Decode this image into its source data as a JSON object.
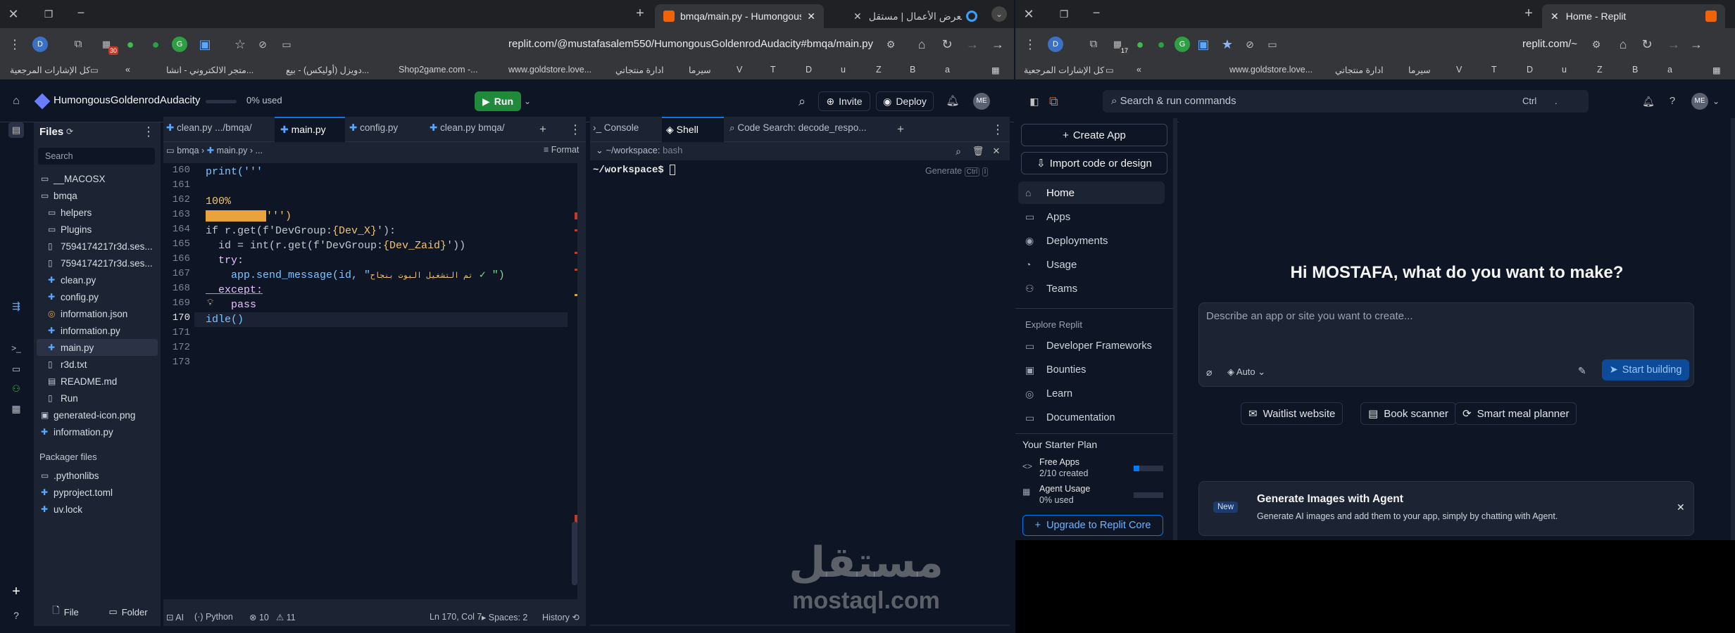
{
  "left_window": {
    "tabs": [
      {
        "title": "bmqa/main.py - HumongousG",
        "active": true
      },
      {
        "title": "إضافة معرض الأعمال | مستقل",
        "active": false
      }
    ],
    "url": "replit.com/@mustafasalem550/HumongousGoldenrodAudacity#bmqa/main.py",
    "ext_badge": "30",
    "bookmarks": [
      "كل الإشارات المرجعية",
      "متجر الالكتروني - انشا...",
      "دويزل (أوليكس) - بيع...",
      "Shop2game.com -...",
      "www.goldstore.love...",
      "ادارة منتجاتي",
      "سيرما",
      "V",
      "T",
      "D",
      "u",
      "Z",
      "B",
      "a"
    ]
  },
  "right_window": {
    "tabs": [
      {
        "title": "Home - Replit",
        "active": true
      }
    ],
    "url": "replit.com/~",
    "ext_badge": "17",
    "bookmarks": [
      "كل الإشارات المرجعية",
      "www.goldstore.love...",
      "ادارة منتجاتي",
      "سيرما",
      "V",
      "T",
      "D",
      "u",
      "Z",
      "B",
      "a"
    ]
  },
  "ide": {
    "repl_name": "HumongousGoldenrodAudacity",
    "usage": "0% used",
    "run_label": "Run",
    "invite_label": "Invite",
    "deploy_label": "Deploy",
    "avatar": "ME",
    "files_title": "Files",
    "search_placeholder": "Search",
    "tree": [
      {
        "name": "__MACOSX",
        "type": "folder",
        "indent": 0
      },
      {
        "name": "bmqa",
        "type": "folder",
        "indent": 0
      },
      {
        "name": "helpers",
        "type": "folder",
        "indent": 1
      },
      {
        "name": "Plugins",
        "type": "folder",
        "indent": 1
      },
      {
        "name": "7594174217r3d.ses...",
        "type": "file",
        "indent": 1
      },
      {
        "name": "7594174217r3d.ses...",
        "type": "file",
        "indent": 1
      },
      {
        "name": "clean.py",
        "type": "py",
        "indent": 1
      },
      {
        "name": "config.py",
        "type": "py",
        "indent": 1
      },
      {
        "name": "information.json",
        "type": "json",
        "indent": 1
      },
      {
        "name": "information.py",
        "type": "py",
        "indent": 1
      },
      {
        "name": "main.py",
        "type": "py",
        "indent": 1,
        "selected": true
      },
      {
        "name": "r3d.txt",
        "type": "file",
        "indent": 1
      },
      {
        "name": "README.md",
        "type": "md",
        "indent": 1
      },
      {
        "name": "Run",
        "type": "file",
        "indent": 1
      },
      {
        "name": "generated-icon.png",
        "type": "img",
        "indent": 0
      },
      {
        "name": "information.py",
        "type": "py",
        "indent": 0
      }
    ],
    "packager_title": "Packager files",
    "packager": [
      {
        "name": ".pythonlibs",
        "type": "folder"
      },
      {
        "name": "pyproject.toml",
        "type": "py"
      },
      {
        "name": "uv.lock",
        "type": "py"
      }
    ],
    "new_file": "File",
    "new_folder": "Folder",
    "editor_tabs": [
      "clean.py .../bmqa/",
      "main.py",
      "config.py",
      "clean.py bmqa/"
    ],
    "breadcrumb": [
      "bmqa",
      "main.py",
      "..."
    ],
    "format_label": "Format",
    "code": {
      "print_line": "print('''",
      "pct": "100%",
      "close_str": "''')",
      "l164_a": "if r.get(f'DevGroup:",
      "l164_b": "{Dev_X}",
      "l164_c": "'):",
      "l165_a": "  id = int(r.get(f'DevGroup:",
      "l165_b": "{Dev_Zaid}",
      "l165_c": "'))",
      "l166": "  try:",
      "l167_a": "    app.send_message(id, \"",
      "l167_b": "تم التشغيل البوت بنجاح",
      "l167_c": " ✓ \")",
      "l168": "  except:",
      "l169": "    pass",
      "l170": "idle()",
      "line_numbers": [
        "160",
        "161",
        "162",
        "163",
        "164",
        "165",
        "166",
        "167",
        "168",
        "169",
        "170",
        "171",
        "172",
        "173"
      ]
    },
    "status": {
      "ai": "AI",
      "lang": "Python",
      "errors": "10",
      "warnings": "11",
      "position": "Ln 170, Col 7",
      "spaces": "Spaces: 2",
      "history": "History"
    },
    "shell_tabs": [
      "Console",
      "Shell",
      "Code Search: decode_respo..."
    ],
    "shell_path": "~/workspace:",
    "shell_type": "bash",
    "prompt": "~/workspace$",
    "generate_label": "Generate",
    "generate_kbd": "Ctrl",
    "generate_kbd2": "I"
  },
  "home": {
    "search_label": "Search & run commands",
    "kbd": "Ctrl",
    "kbd2": ".",
    "avatar": "ME",
    "create_app": "Create App",
    "import": "Import code or design",
    "nav": [
      "Home",
      "Apps",
      "Deployments",
      "Usage",
      "Teams"
    ],
    "explore_title": "Explore Replit",
    "explore": [
      "Developer Frameworks",
      "Bounties",
      "Learn",
      "Documentation"
    ],
    "plan_title": "Your Starter Plan",
    "free_apps": "Free Apps",
    "free_apps_sub": "2/10 created",
    "free_apps_fraction": 0.2,
    "agent_usage": "Agent Usage",
    "agent_usage_sub": "0% used",
    "upgrade": "Upgrade to Replit Core",
    "headline": "Hi MOSTAFA, what do you want to make?",
    "prompt_placeholder": "Describe an app or site you want to create...",
    "auto_label": "Auto",
    "start_building": "Start building",
    "suggestions": [
      "Waitlist website",
      "Book scanner",
      "Smart meal planner"
    ],
    "banner_badge": "New",
    "banner_title": "Generate Images with Agent",
    "banner_text": "Generate AI images and add them to your app, simply by chatting with Agent."
  },
  "watermark": {
    "arabic": "مستقل",
    "latin": "mostaql.com"
  },
  "colors": {
    "accent": "#0079f2",
    "run": "#1f8a3a",
    "bg": "#0e1525",
    "panel": "#1c2333"
  }
}
